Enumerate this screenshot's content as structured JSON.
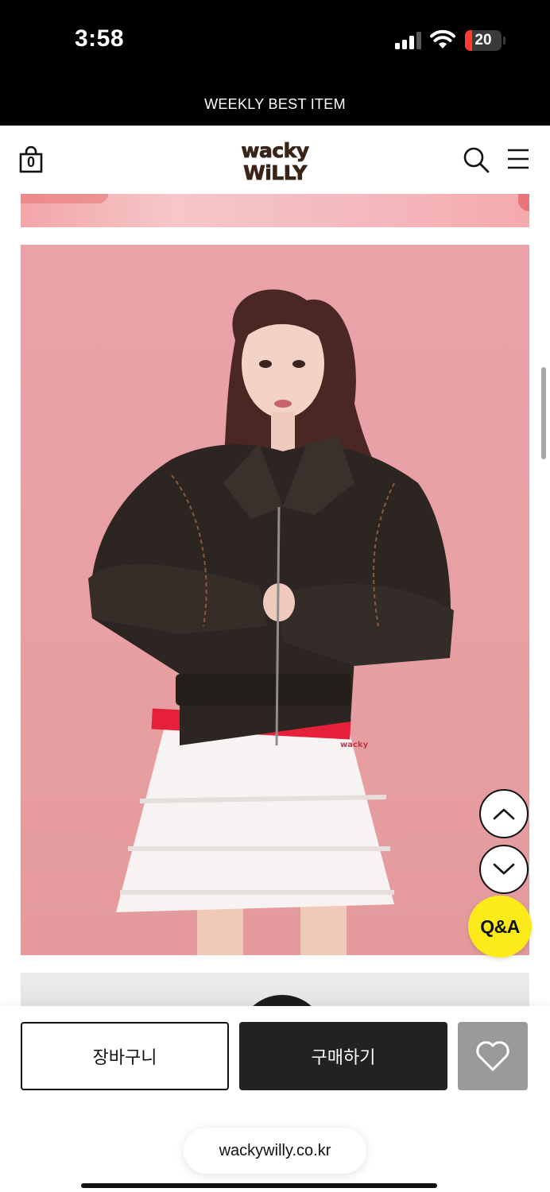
{
  "status_bar": {
    "time": "3:58",
    "battery_level": "20",
    "battery_fraction": 0.2,
    "icons": [
      "cellular-signal-icon",
      "wifi-icon",
      "battery-icon"
    ]
  },
  "promo_banner": {
    "text": "WEEKLY BEST ITEM"
  },
  "header": {
    "cart_count": "0",
    "logo_text": [
      "wacky",
      "WiLLY"
    ],
    "icons": [
      "shopping-bag-icon",
      "search-icon",
      "menu-icon"
    ]
  },
  "content": {
    "product_image_label": "wacky"
  },
  "floating_buttons": {
    "qna_label": "Q&A",
    "icons": [
      "chevron-up-icon",
      "chevron-down-icon"
    ]
  },
  "action_bar": {
    "cart_label": "장바구니",
    "buy_label": "구매하기",
    "icons": [
      "heart-icon"
    ]
  },
  "browser": {
    "url": "wackywilly.co.kr"
  },
  "colors": {
    "background_pink": "#e9a2a8",
    "qna_yellow": "#fcea1a",
    "buy_dark": "#222222",
    "wish_gray": "#9a9a9a",
    "battery_red": "#ff3b30"
  }
}
